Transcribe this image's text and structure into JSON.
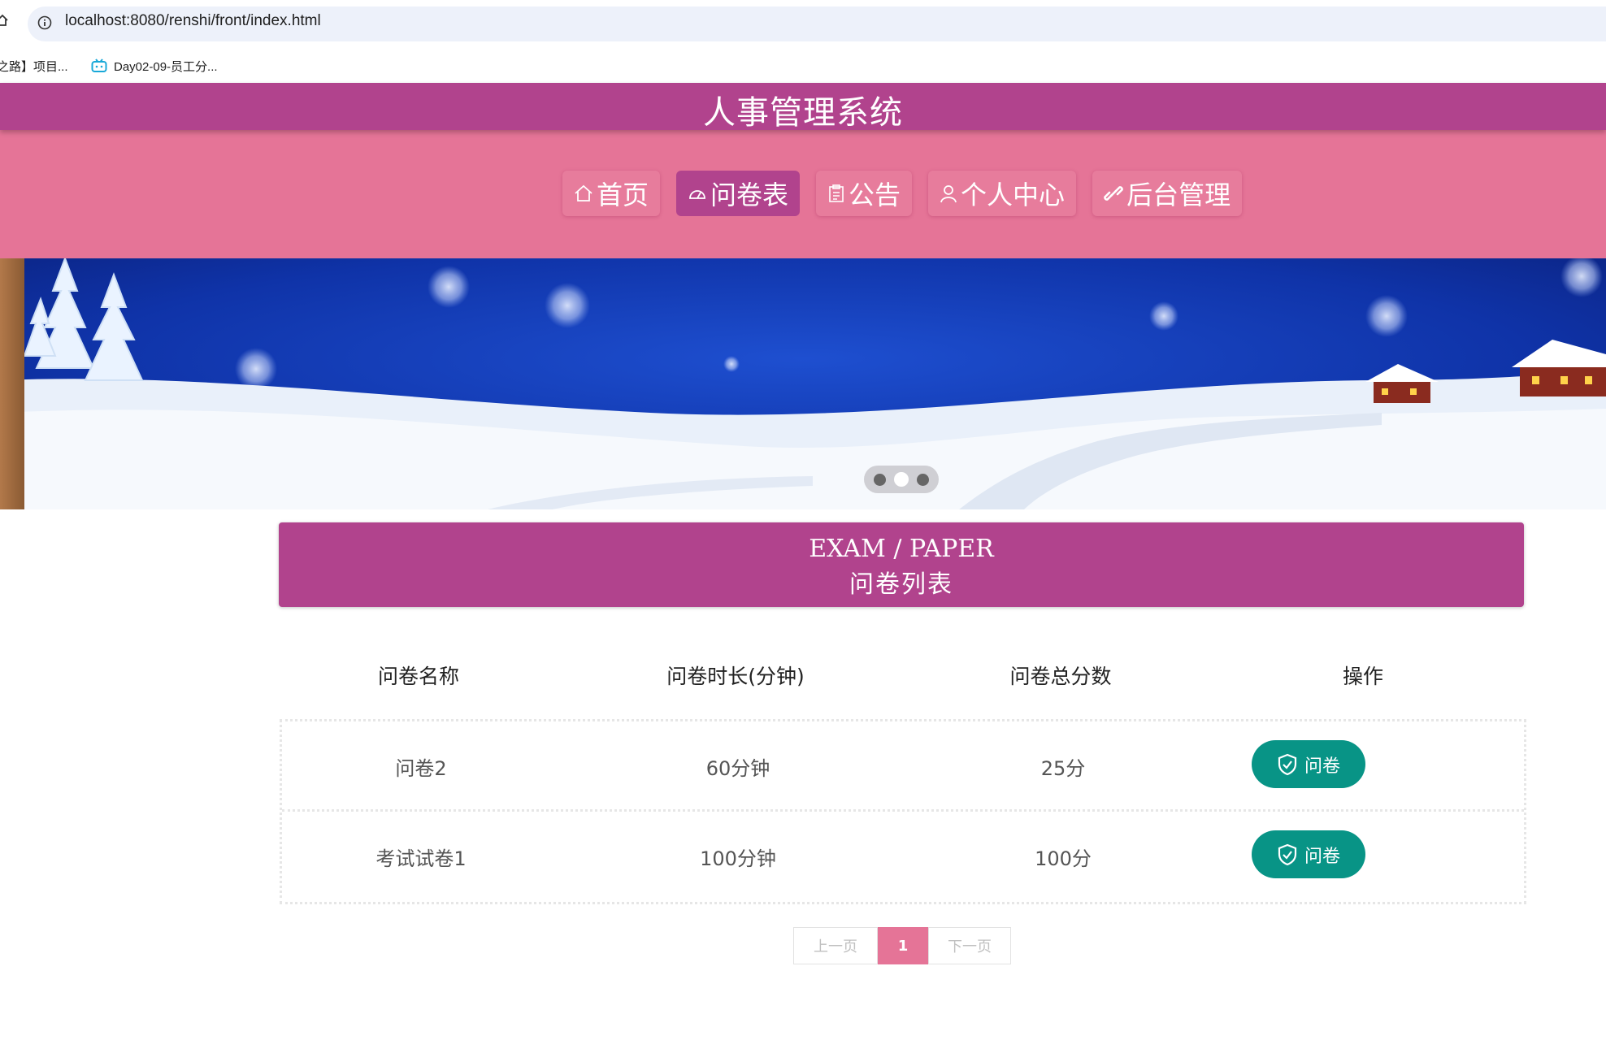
{
  "browser": {
    "url": "localhost:8080/renshi/front/index.html",
    "bookmarks": [
      {
        "label": "之路】项目..."
      },
      {
        "label": "Day02-09-员工分..."
      }
    ]
  },
  "site": {
    "title": "人事管理系统"
  },
  "nav": {
    "items": [
      {
        "label": "首页",
        "icon": "home-icon",
        "active": false
      },
      {
        "label": "问卷表",
        "icon": "dashboard-icon",
        "active": true
      },
      {
        "label": "公告",
        "icon": "clipboard-icon",
        "active": false
      },
      {
        "label": "个人中心",
        "icon": "user-icon",
        "active": false
      },
      {
        "label": "后台管理",
        "icon": "link-icon",
        "active": false
      }
    ]
  },
  "carousel": {
    "slide_count": 3,
    "active_index": 1
  },
  "section": {
    "title_en": "EXAM / PAPER",
    "title_cn": "问卷列表"
  },
  "table": {
    "headers": [
      "问卷名称",
      "问卷时长(分钟)",
      "问卷总分数",
      "操作"
    ],
    "rows": [
      {
        "name": "问卷2",
        "duration": "60分钟",
        "score": "25分",
        "action": "问卷"
      },
      {
        "name": "考试试卷1",
        "duration": "100分钟",
        "score": "100分",
        "action": "问卷"
      }
    ]
  },
  "pagination": {
    "prev": "上一页",
    "current": "1",
    "next": "下一页"
  },
  "colors": {
    "header_purple": "#b1438d",
    "nav_pink": "#e57497",
    "teal_button": "#089486"
  }
}
